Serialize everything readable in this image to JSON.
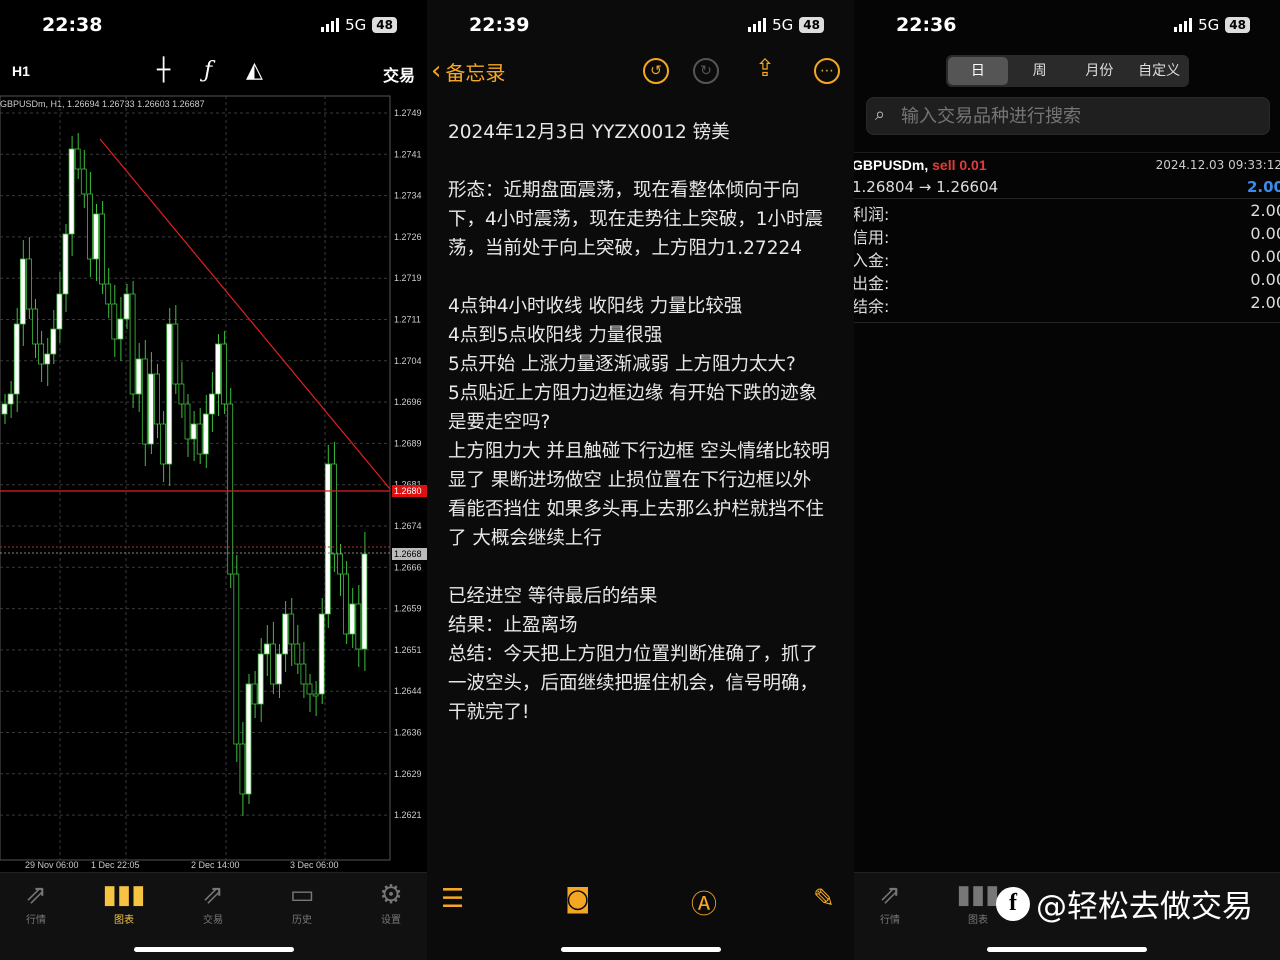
{
  "panel_chart": {
    "status": {
      "time": "22:38",
      "network": "5G",
      "battery": "48"
    },
    "toolbar": {
      "timeframe": "H1",
      "crosshair_icon": "crosshair-icon",
      "indicator_icon": "function-icon",
      "objects_icon": "shapes-icon",
      "trade_label": "交易"
    },
    "info_line": "GBPUSDm, H1, 1.26694 1.26733 1.26603 1.26687",
    "price_labels": [
      "1.2749",
      "1.2741",
      "1.2734",
      "1.2726",
      "1.2719",
      "1.2711",
      "1.2704",
      "1.2696",
      "1.2689",
      "1.2681",
      "1.2674",
      "1.2666",
      "1.2659",
      "1.2651",
      "1.2644",
      "1.2636",
      "1.2629",
      "1.2621"
    ],
    "red_level_label": "1.2680",
    "current_price_label": "1.2668",
    "time_labels": [
      "29 Nov 06:00",
      "1 Dec 22:05",
      "2 Dec 14:00",
      "3 Dec 06:00"
    ],
    "tabs": [
      {
        "label": "行情",
        "icon": "quotes-icon"
      },
      {
        "label": "图表",
        "icon": "candles-icon"
      },
      {
        "label": "交易",
        "icon": "trade-icon"
      },
      {
        "label": "历史",
        "icon": "inbox-icon"
      },
      {
        "label": "设置",
        "icon": "gear-icon"
      }
    ],
    "active_tab": "图表",
    "colors": {
      "accent": "#f6c343",
      "trendline": "#e02020",
      "candle": "#ffffff"
    }
  },
  "panel_notes": {
    "status": {
      "time": "22:39",
      "network": "5G",
      "battery": "48"
    },
    "nav": {
      "back_label": "备忘录"
    },
    "lines": [
      "2024年12月3日 YYZX0012 镑美",
      "",
      "形态：近期盘面震荡，现在看整体倾向于向下，4小时震荡，现在走势往上突破，1小时震荡，当前处于向上突破，上方阻力1.27224",
      "",
      "4点钟4小时收线 收阳线 力量比较强",
      "4点到5点收阳线 力量很强",
      "5点开始 上涨力量逐渐减弱 上方阻力太大?",
      "5点贴近上方阻力边框边缘 有开始下跌的迹象 是要走空吗?",
      "上方阻力大 并且触碰下行边框 空头情绪比较明显了 果断进场做空 止损位置在下行边框以外 看能否挡住 如果多头再上去那么护栏就挡不住了 大概会继续上行",
      "",
      "已经进空 等待最后的结果",
      "结果：止盈离场",
      "总结：今天把上方阻力位置判断准确了，抓了一波空头，后面继续把握住机会，信号明确，干就完了!"
    ],
    "accent": "#f5a623"
  },
  "panel_history": {
    "status": {
      "time": "22:36",
      "network": "5G",
      "battery": "48"
    },
    "segments": [
      "日",
      "周",
      "月份",
      "自定义"
    ],
    "active_segment": "日",
    "search_placeholder": "输入交易品种进行搜索",
    "deal": {
      "symbol": "GBPUSDm,",
      "side": "sell 0.01",
      "time": "2024.12.03 09:33:12",
      "prices": "1.26804 → 1.26604",
      "profit": "2.00"
    },
    "summary": [
      {
        "label": "利润:",
        "value": "2.00"
      },
      {
        "label": "信用:",
        "value": "0.00"
      },
      {
        "label": "入金:",
        "value": "0.00"
      },
      {
        "label": "出金:",
        "value": "0.00"
      },
      {
        "label": "结余:",
        "value": "2.00"
      }
    ],
    "tabs": [
      {
        "label": "行情",
        "icon": "quotes-icon"
      },
      {
        "label": "图表",
        "icon": "candles-icon"
      }
    ],
    "watermark": "@轻松去做交易"
  }
}
